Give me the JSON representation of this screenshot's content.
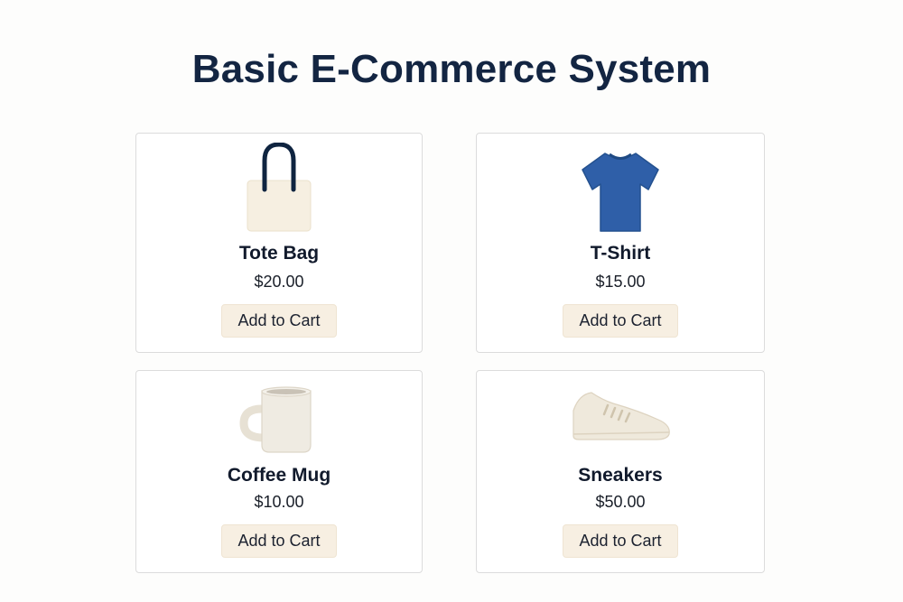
{
  "page": {
    "title": "Basic E-Commerce System"
  },
  "products": [
    {
      "name": "Tote Bag",
      "price": "$20.00",
      "button_label": "Add to Cart",
      "icon": "tote-bag-icon"
    },
    {
      "name": "T-Shirt",
      "price": "$15.00",
      "button_label": "Add to Cart",
      "icon": "t-shirt-icon"
    },
    {
      "name": "Coffee Mug",
      "price": "$10.00",
      "button_label": "Add to Cart",
      "icon": "coffee-mug-icon"
    },
    {
      "name": "Sneakers",
      "price": "$50.00",
      "button_label": "Add to Cart",
      "icon": "sneakers-icon"
    }
  ],
  "colors": {
    "title": "#132542",
    "button_bg": "#f7efe2",
    "card_border": "#dcdcdc",
    "tshirt": "#2f5fa8",
    "tote_handle": "#0f2440",
    "tote_body": "#f6efe1",
    "mug": "#efebe2",
    "sneaker": "#efe9dc"
  }
}
